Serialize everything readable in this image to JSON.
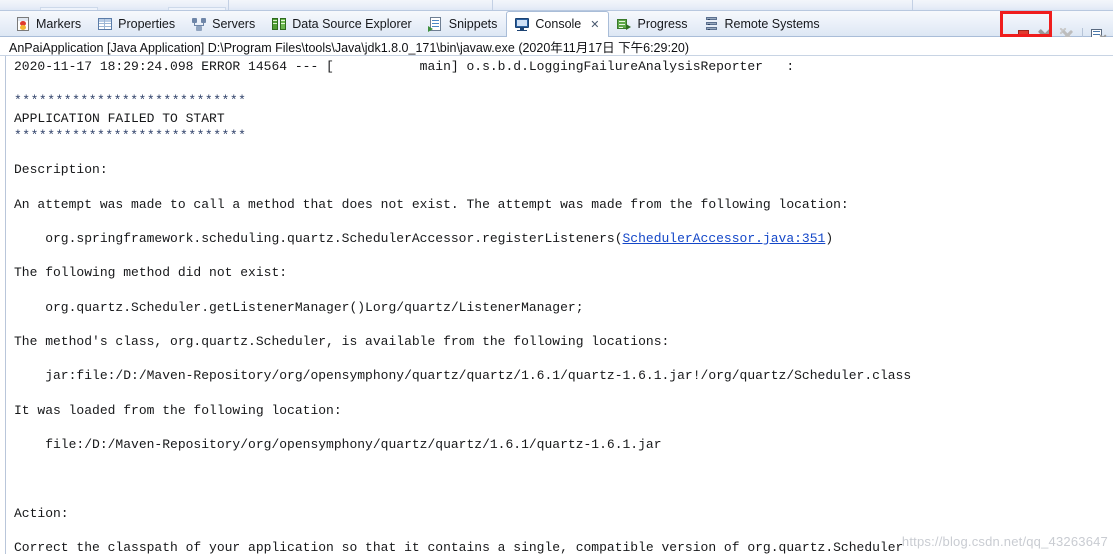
{
  "window": {
    "app": "Eclipse IDE",
    "active_view": "Console"
  },
  "tabs": [
    {
      "id": "markers",
      "label": "Markers",
      "icon": "markers-icon",
      "active": false
    },
    {
      "id": "properties",
      "label": "Properties",
      "icon": "properties-icon",
      "active": false
    },
    {
      "id": "servers",
      "label": "Servers",
      "icon": "servers-icon",
      "active": false
    },
    {
      "id": "dse",
      "label": "Data Source Explorer",
      "icon": "data-source-explorer-icon",
      "active": false
    },
    {
      "id": "snippets",
      "label": "Snippets",
      "icon": "snippets-icon",
      "active": false
    },
    {
      "id": "console",
      "label": "Console",
      "icon": "console-icon",
      "active": true,
      "close": "✕"
    },
    {
      "id": "progress",
      "label": "Progress",
      "icon": "progress-icon",
      "active": false
    },
    {
      "id": "remote",
      "label": "Remote Systems",
      "icon": "remote-systems-icon",
      "active": false
    }
  ],
  "toolbar": {
    "terminate_label": "Terminate",
    "remove_launch_label": "Remove Launch",
    "remove_all_terminated_label": "Remove All Terminated Launches",
    "clear_console_label": "Clear Console",
    "highlight_color": "#ef1d1d",
    "terminate_color": "#e03b2f"
  },
  "process": {
    "title": "AnPaiApplication [Java Application] D:\\Program Files\\tools\\Java\\jdk1.8.0_171\\bin\\javaw.exe (2020年11月17日 下午6:29:20)"
  },
  "console": {
    "link_color": "#1447c8",
    "lines": [
      {
        "text": "2020-11-17 18:29:24.098 ERROR 14564 --- [           main] o.s.b.d.LoggingFailureAnalysisReporter   :"
      },
      {
        "text": ""
      },
      {
        "text": "****************************",
        "style": "stars"
      },
      {
        "text": "APPLICATION FAILED TO START"
      },
      {
        "text": "****************************",
        "style": "stars"
      },
      {
        "text": ""
      },
      {
        "text": "Description:"
      },
      {
        "text": ""
      },
      {
        "text": "An attempt was made to call a method that does not exist. The attempt was made from the following location:"
      },
      {
        "text": ""
      },
      {
        "pre": "    org.springframework.scheduling.quartz.SchedulerAccessor.registerListeners(",
        "link": "SchedulerAccessor.java:351",
        "post": ")"
      },
      {
        "text": ""
      },
      {
        "text": "The following method did not exist:"
      },
      {
        "text": ""
      },
      {
        "text": "    org.quartz.Scheduler.getListenerManager()Lorg/quartz/ListenerManager;"
      },
      {
        "text": ""
      },
      {
        "text": "The method's class, org.quartz.Scheduler, is available from the following locations:"
      },
      {
        "text": ""
      },
      {
        "text": "    jar:file:/D:/Maven-Repository/org/opensymphony/quartz/quartz/1.6.1/quartz-1.6.1.jar!/org/quartz/Scheduler.class"
      },
      {
        "text": ""
      },
      {
        "text": "It was loaded from the following location:"
      },
      {
        "text": ""
      },
      {
        "text": "    file:/D:/Maven-Repository/org/opensymphony/quartz/quartz/1.6.1/quartz-1.6.1.jar"
      },
      {
        "text": ""
      },
      {
        "text": ""
      },
      {
        "text": ""
      },
      {
        "text": "Action:"
      },
      {
        "text": ""
      },
      {
        "text": "Correct the classpath of your application so that it contains a single, compatible version of org.quartz.Scheduler"
      }
    ]
  },
  "watermark": {
    "text": "https://blog.csdn.net/qq_43263647"
  }
}
